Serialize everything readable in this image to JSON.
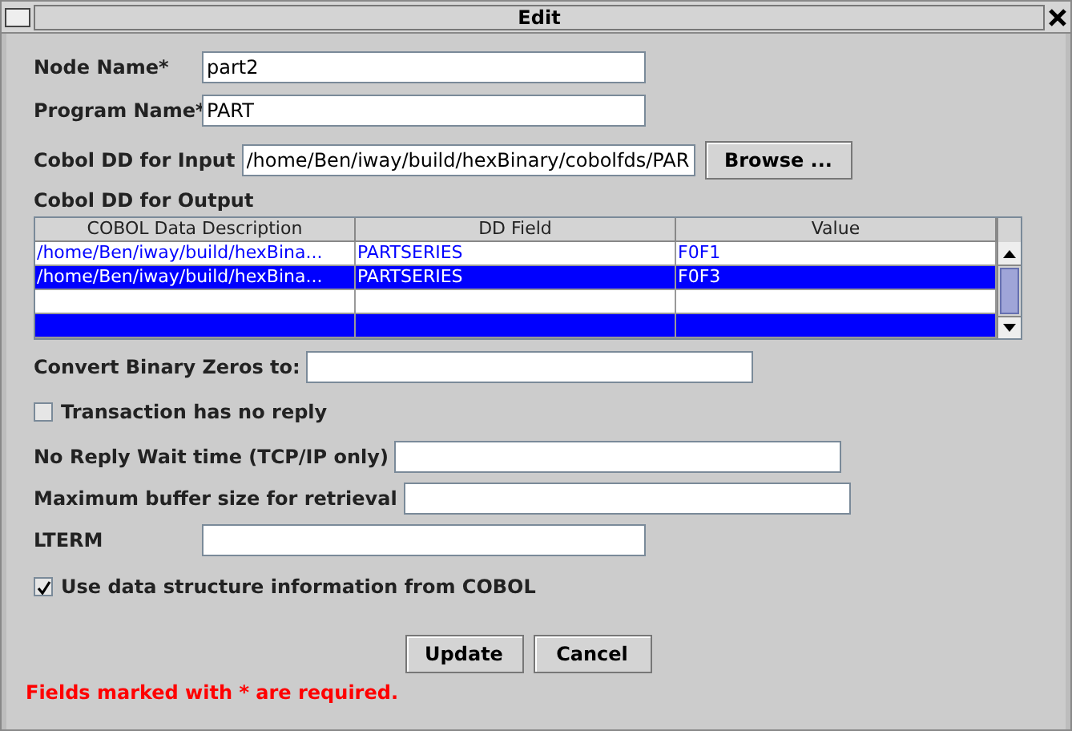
{
  "window": {
    "title": "Edit"
  },
  "node_name": {
    "label": "Node Name*",
    "value": "part2"
  },
  "program_name": {
    "label": "Program Name*",
    "value": "PART"
  },
  "input_dd": {
    "label": "Cobol DD for Input",
    "value": "/home/Ben/iway/build/hexBinary/cobolfds/PAR",
    "button": "Browse ..."
  },
  "output_dd": {
    "label": "Cobol DD for Output",
    "table": {
      "columns": [
        "COBOL Data Description",
        "DD Field",
        "Value"
      ],
      "rows": [
        {
          "selected": false,
          "cells": [
            "/home/Ben/iway/build/hexBina...",
            "PARTSERIES",
            "F0F1"
          ]
        },
        {
          "selected": true,
          "cells": [
            "/home/Ben/iway/build/hexBina...",
            "PARTSERIES",
            "F0F3"
          ]
        },
        {
          "selected": false
        },
        {
          "selected": true
        }
      ]
    }
  },
  "binary_zeros": {
    "label": "Convert Binary Zeros to:"
  },
  "no_reply": {
    "label": "Transaction has no reply",
    "checked": false
  },
  "wait_time": {
    "label": "No Reply Wait time (TCP/IP only)"
  },
  "buffer_size": {
    "label": "Maximum buffer size for retrieval"
  },
  "lterm": {
    "label": "LTERM"
  },
  "use_structure": {
    "label": "Use data structure information from COBOL",
    "checked": true
  },
  "buttons": [
    "Update",
    "Cancel"
  ],
  "footer": "Fields marked with * are required."
}
